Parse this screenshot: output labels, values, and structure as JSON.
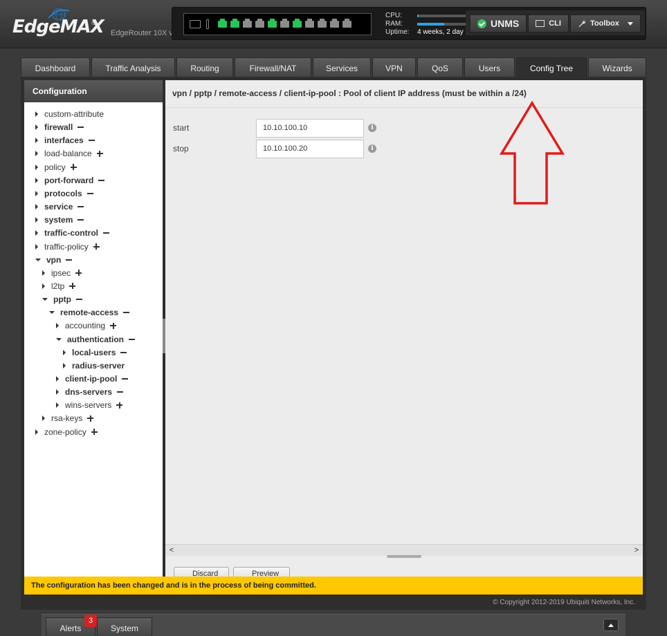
{
  "header": {
    "logo_text": "EdgeMAX",
    "logo_mark": "®",
    "model": "EdgeRouter 10X v",
    "sysinfo": {
      "cpu_label": "CPU:",
      "cpu_level": 0.03,
      "ram_label": "RAM:",
      "ram_level": 0.55,
      "uptime_label": "Uptime:",
      "uptime_value": "4 weeks, 2 day"
    },
    "ports": [
      "sfp",
      "up",
      "up",
      "down",
      "down",
      "up",
      "down",
      "up",
      "down",
      "down",
      "down",
      "down"
    ],
    "unms_label": "UNMS",
    "cli_label": "CLI",
    "toolbox_label": "Toolbox"
  },
  "tabs": [
    "Dashboard",
    "Traffic Analysis",
    "Routing",
    "Firewall/NAT",
    "Services",
    "VPN",
    "QoS",
    "Users",
    "Config Tree",
    "Wizards"
  ],
  "active_tab": "Config Tree",
  "sidebar": {
    "title": "Configuration",
    "tree": [
      {
        "label": "custom-attribute",
        "depth": 0,
        "expanded": false,
        "bold": false,
        "toggle": ""
      },
      {
        "label": "firewall",
        "depth": 0,
        "expanded": false,
        "bold": true,
        "toggle": "minus"
      },
      {
        "label": "interfaces",
        "depth": 0,
        "expanded": false,
        "bold": true,
        "toggle": "minus"
      },
      {
        "label": "load-balance",
        "depth": 0,
        "expanded": false,
        "bold": false,
        "toggle": "plus"
      },
      {
        "label": "policy",
        "depth": 0,
        "expanded": false,
        "bold": false,
        "toggle": "plus"
      },
      {
        "label": "port-forward",
        "depth": 0,
        "expanded": false,
        "bold": true,
        "toggle": "minus"
      },
      {
        "label": "protocols",
        "depth": 0,
        "expanded": false,
        "bold": true,
        "toggle": "minus"
      },
      {
        "label": "service",
        "depth": 0,
        "expanded": false,
        "bold": true,
        "toggle": "minus"
      },
      {
        "label": "system",
        "depth": 0,
        "expanded": false,
        "bold": true,
        "toggle": "minus"
      },
      {
        "label": "traffic-control",
        "depth": 0,
        "expanded": false,
        "bold": true,
        "toggle": "minus"
      },
      {
        "label": "traffic-policy",
        "depth": 0,
        "expanded": false,
        "bold": false,
        "toggle": "plus"
      },
      {
        "label": "vpn",
        "depth": 0,
        "expanded": true,
        "bold": true,
        "toggle": "minus"
      },
      {
        "label": "ipsec",
        "depth": 1,
        "expanded": false,
        "bold": false,
        "toggle": "plus"
      },
      {
        "label": "l2tp",
        "depth": 1,
        "expanded": false,
        "bold": false,
        "toggle": "plus"
      },
      {
        "label": "pptp",
        "depth": 1,
        "expanded": true,
        "bold": true,
        "toggle": "minus"
      },
      {
        "label": "remote-access",
        "depth": 2,
        "expanded": true,
        "bold": true,
        "toggle": "minus"
      },
      {
        "label": "accounting",
        "depth": 3,
        "expanded": false,
        "bold": false,
        "toggle": "plus"
      },
      {
        "label": "authentication",
        "depth": 3,
        "expanded": true,
        "bold": true,
        "toggle": "minus"
      },
      {
        "label": "local-users",
        "depth": 4,
        "expanded": false,
        "bold": true,
        "toggle": "minus"
      },
      {
        "label": "radius-server",
        "depth": 4,
        "expanded": false,
        "bold": true,
        "toggle": ""
      },
      {
        "label": "client-ip-pool",
        "depth": 3,
        "expanded": false,
        "bold": true,
        "toggle": "minus"
      },
      {
        "label": "dns-servers",
        "depth": 3,
        "expanded": false,
        "bold": true,
        "toggle": "minus"
      },
      {
        "label": "wins-servers",
        "depth": 3,
        "expanded": false,
        "bold": false,
        "toggle": "plus"
      },
      {
        "label": "rsa-keys",
        "depth": 1,
        "expanded": false,
        "bold": false,
        "toggle": "plus"
      },
      {
        "label": "zone-policy",
        "depth": 0,
        "expanded": false,
        "bold": false,
        "toggle": "plus"
      }
    ]
  },
  "content": {
    "title": "vpn / pptp / remote-access / client-ip-pool : Pool of client IP address (must be within a /24)",
    "fields": [
      {
        "label": "start",
        "value": "10.10.100.10"
      },
      {
        "label": "stop",
        "value": "10.10.100.20"
      }
    ],
    "discard_label": "Discard",
    "preview_label": "Preview"
  },
  "notice": "The configuration has been changed and is in the process of being committed.",
  "copyright": "© Copyright 2012-2019 Ubiquiti Networks, Inc.",
  "footer": {
    "alerts_label": "Alerts",
    "alerts_count": "3",
    "system_label": "System"
  },
  "colors": {
    "port_up": "#27c45a",
    "port_down": "#8c8c8c",
    "notice_bg": "#ffc800",
    "annotation_arrow": "#e01b1b",
    "meter": "#27a4e6"
  }
}
